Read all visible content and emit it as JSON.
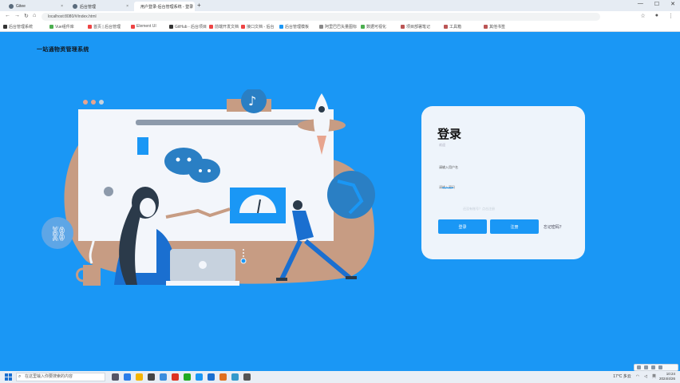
{
  "browser": {
    "tabs": [
      {
        "label": "Gitee",
        "active": false
      },
      {
        "label": "后台管理",
        "active": false
      },
      {
        "label": "用户登录-后台管理系统 - 登录",
        "active": true
      }
    ],
    "url": "localhost:8080/#/index.html",
    "bookmarks": [
      "后台管理系统",
      "Vue组件库",
      "首页 | 后台管理",
      "Element UI",
      "GitHub - 后台项目",
      "前端开发文档",
      "接口文档 - 后台",
      "后台管理模板",
      "阿里巴巴矢量图标",
      "数据可视化",
      "项目部署笔记",
      "工具箱",
      "其他书签"
    ]
  },
  "brand": {
    "name": "一站通物资管理系统"
  },
  "login": {
    "title": "登录",
    "subtitle": "欢迎",
    "username_value": "请输入用户名",
    "password_placeholder": "请输入密码",
    "hint": "还没有账号？点击注册",
    "login_button": "登录",
    "register_button": "注册",
    "forgot_link": "忘记密码？"
  },
  "taskbar": {
    "search_placeholder": "在这里输入你要搜索的内容",
    "tray_weather": "17°C 多云",
    "tray_lang": "英",
    "clock_time": "10:24",
    "clock_date": "2024/4/26"
  },
  "colors": {
    "background": "#1a97f5",
    "card": "#eef4fb",
    "accent": "#1a97f5",
    "illustration_brown": "#c79c83",
    "illustration_dark": "#2b3a4a"
  },
  "icons": [
    "tiktok-icon",
    "wechat-icon",
    "link-icon",
    "rocket-icon",
    "gauge-icon"
  ]
}
